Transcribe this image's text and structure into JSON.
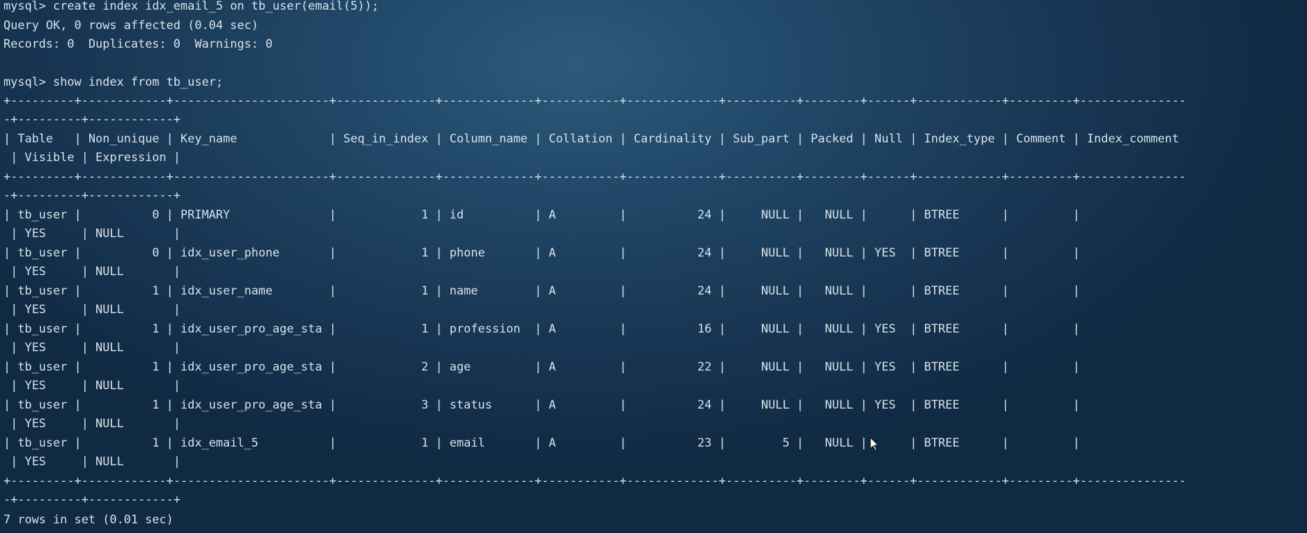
{
  "terminal": {
    "lines": [
      "mysql> create index idx_email_5 on tb_user(email(5));",
      "Query OK, 0 rows affected (0.04 sec)",
      "Records: 0  Duplicates: 0  Warnings: 0",
      "",
      "mysql> show index from tb_user;",
      "+---------+------------+----------------------+--------------+-------------+-----------+-------------+----------+--------+------+------------+---------+---------------",
      "-+---------+------------+",
      "| Table   | Non_unique | Key_name             | Seq_in_index | Column_name | Collation | Cardinality | Sub_part | Packed | Null | Index_type | Comment | Index_comment",
      " | Visible | Expression |",
      "+---------+------------+----------------------+--------------+-------------+-----------+-------------+----------+--------+------+------------+---------+---------------",
      "-+---------+------------+",
      "| tb_user |          0 | PRIMARY              |            1 | id          | A         |          24 |     NULL |   NULL |      | BTREE      |         |",
      " | YES     | NULL       |",
      "| tb_user |          0 | idx_user_phone       |            1 | phone       | A         |          24 |     NULL |   NULL | YES  | BTREE      |         |",
      " | YES     | NULL       |",
      "| tb_user |          1 | idx_user_name        |            1 | name        | A         |          24 |     NULL |   NULL |      | BTREE      |         |",
      " | YES     | NULL       |",
      "| tb_user |          1 | idx_user_pro_age_sta |            1 | profession  | A         |          16 |     NULL |   NULL | YES  | BTREE      |         |",
      " | YES     | NULL       |",
      "| tb_user |          1 | idx_user_pro_age_sta |            2 | age         | A         |          22 |     NULL |   NULL | YES  | BTREE      |         |",
      " | YES     | NULL       |",
      "| tb_user |          1 | idx_user_pro_age_sta |            3 | status      | A         |          24 |     NULL |   NULL | YES  | BTREE      |         |",
      " | YES     | NULL       |",
      "| tb_user |          1 | idx_email_5          |            1 | email       | A         |          23 |        5 |   NULL |      | BTREE      |         |",
      " | YES     | NULL       |",
      "+---------+------------+----------------------+--------------+-------------+-----------+-------------+----------+--------+------+------------+---------+---------------",
      "-+---------+------------+",
      "7 rows in set (0.01 sec)"
    ]
  }
}
